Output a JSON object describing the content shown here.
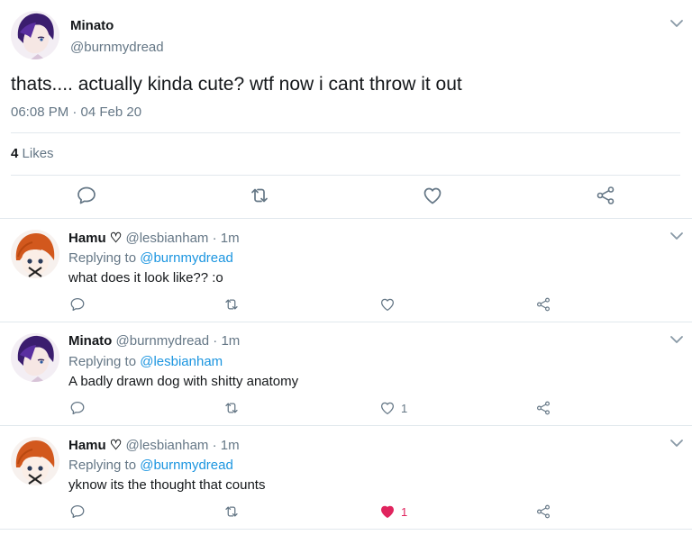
{
  "main_tweet": {
    "author_name": "Minato",
    "author_handle": "@burnmydread",
    "text": "thats.... actually kinda cute? wtf now i cant throw it out",
    "timestamp": "06:08 PM · 04 Feb 20",
    "likes_count": "4",
    "likes_label": "Likes"
  },
  "replies": [
    {
      "author_name": "Hamu ♡",
      "author_handle": "@lesbianham · 1m",
      "replying_prefix": "Replying to",
      "replying_handle": "@burnmydread",
      "text": "what does it look like?? :o",
      "like_count": "",
      "liked": false
    },
    {
      "author_name": "Minato",
      "author_handle": "@burnmydread · 1m",
      "replying_prefix": "Replying to",
      "replying_handle": "@lesbianham",
      "text": "A badly drawn dog with shitty anatomy",
      "like_count": "1",
      "liked": false
    },
    {
      "author_name": "Hamu ♡",
      "author_handle": "@lesbianham · 1m",
      "replying_prefix": "Replying to",
      "replying_handle": "@burnmydread",
      "text": "yknow its the thought that counts",
      "like_count": "1",
      "liked": true
    }
  ],
  "icons": {
    "reply": "reply-icon",
    "retweet": "retweet-icon",
    "like": "heart-icon",
    "share": "share-icon",
    "menu": "chevron-down-icon"
  },
  "colors": {
    "link": "#1b95e0",
    "secondary_text": "#657786",
    "like_active": "#e0245e",
    "divider": "#e1e8ed"
  }
}
